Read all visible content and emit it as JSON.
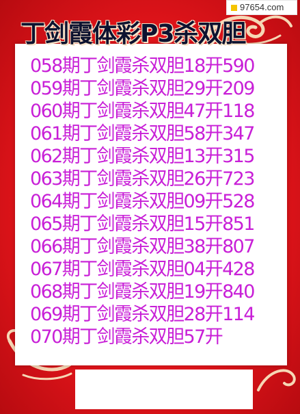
{
  "watermark": {
    "text": "97654.com",
    "icon": "yellow-square-icon"
  },
  "title": "丁剑霞体彩P3杀双胆",
  "lines": [
    "058期丁剑霞杀双胆18开590",
    "059期丁剑霞杀双胆29开209",
    "060期丁剑霞杀双胆47开118",
    "061期丁剑霞杀双胆58开347",
    "062期丁剑霞杀双胆13开315",
    "063期丁剑霞杀双胆26开723",
    "064期丁剑霞杀双胆09开528",
    "065期丁剑霞杀双胆15开851",
    "066期丁剑霞杀双胆38开807",
    "067期丁剑霞杀双胆04开428",
    "068期丁剑霞杀双胆19开840",
    "069期丁剑霞杀双胆28开114",
    "070期丁剑霞杀双胆57开"
  ],
  "colors": {
    "background": "#e41b1f",
    "panel": "#ffffff",
    "text": "#c81fd7",
    "title": "#0d1230",
    "ornament": "#f6d7b5"
  }
}
